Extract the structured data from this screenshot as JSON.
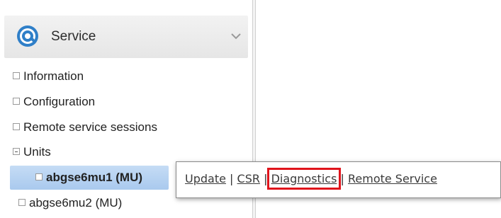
{
  "sidebar": {
    "header": {
      "title": "Service",
      "icon": "service-gear-icon",
      "accent": "#2f7fc8"
    },
    "items": [
      {
        "label": "Information",
        "expander": "collapsed"
      },
      {
        "label": "Configuration",
        "expander": "collapsed"
      },
      {
        "label": "Remote service sessions",
        "expander": "collapsed"
      },
      {
        "label": "Units",
        "expander": "expanded"
      }
    ],
    "units": [
      {
        "label": "abgse6mu1 (MU)",
        "selected": true
      },
      {
        "label": "abgse6mu2 (MU)",
        "selected": false
      }
    ]
  },
  "context_menu": {
    "items": [
      "Update",
      "CSR",
      "Diagnostics",
      "Remote Service"
    ],
    "separator": "|",
    "highlighted": "Diagnostics",
    "highlight_color": "#e0141c"
  }
}
